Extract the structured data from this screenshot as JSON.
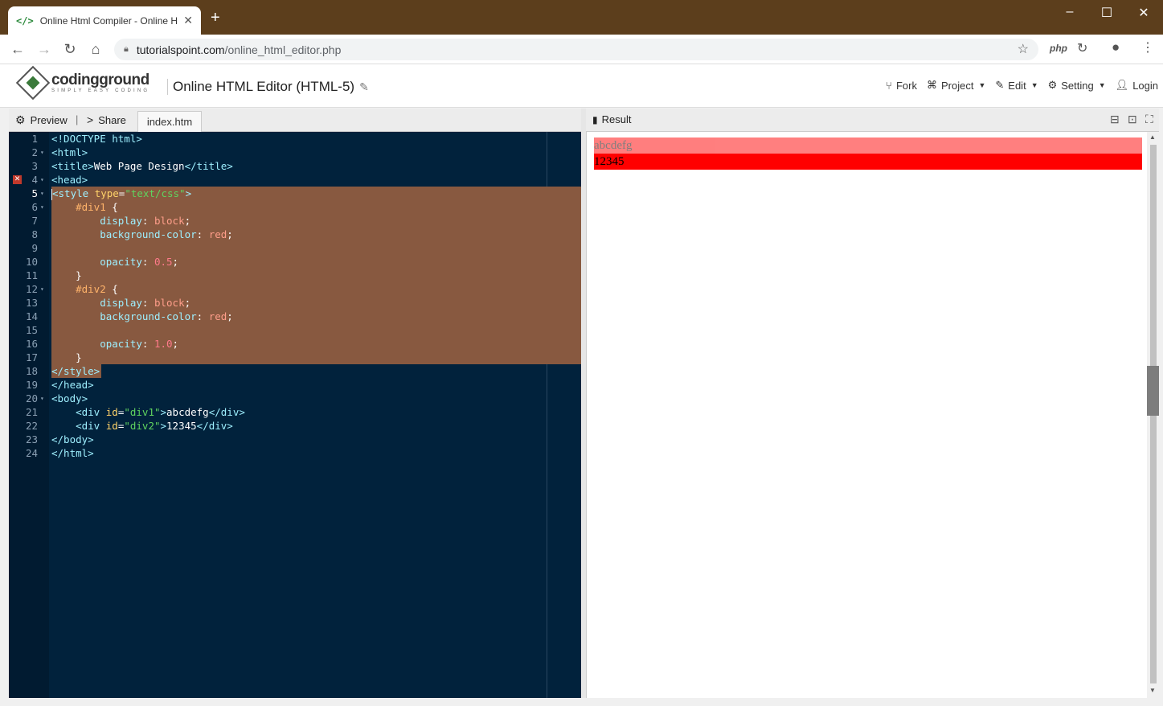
{
  "browser": {
    "tab_title": "Online Html Compiler - Online H",
    "tab_favicon": "</>",
    "new_tab": "+",
    "url_host": "tutorialspoint.com",
    "url_path": "/online_html_editor.php",
    "ext_php": "php"
  },
  "header": {
    "logo_name": "codingground",
    "logo_tagline": "SIMPLY EASY CODING",
    "page_title": "Online HTML Editor (HTML-5)",
    "menu": {
      "fork": "Fork",
      "project": "Project",
      "edit": "Edit",
      "setting": "Setting",
      "login": "Login"
    }
  },
  "editor_bar": {
    "preview": "Preview",
    "separator": "|",
    "share": "Share",
    "file_tab": "index.htm"
  },
  "editor": {
    "error_line": 4,
    "selection": {
      "from_line": 5,
      "to_line": 18
    },
    "line_numbers": [
      "1",
      "2",
      "3",
      "4",
      "5",
      "6",
      "7",
      "8",
      "9",
      "10",
      "11",
      "12",
      "13",
      "14",
      "15",
      "16",
      "17",
      "18",
      "19",
      "20",
      "21",
      "22",
      "23",
      "24"
    ],
    "tokens": {
      "l1": "<!DOCTYPE html>",
      "l2": "<html>",
      "l3_open": "<title>",
      "l3_text": "Web Page Design",
      "l3_close": "</title>",
      "l4": "<head>",
      "l5_tag": "<style",
      "l5_attr": "type",
      "l5_eq": "=",
      "l5_val": "\"text/css\"",
      "l5_end": ">",
      "l6_sel": "#div1",
      "l6_brace": " {",
      "l7_prop": "display",
      "l7_val": "block",
      "l8_prop": "background-color",
      "l8_val": "red",
      "l10_prop": "opacity",
      "l10_val": "0.5",
      "l11": "}",
      "l12_sel": "#div2",
      "l12_brace": " {",
      "l13_prop": "display",
      "l13_val": "block",
      "l14_prop": "background-color",
      "l14_val": "red",
      "l16_prop": "opacity",
      "l16_val": "1.0",
      "l17": "}",
      "l18": "</style>",
      "l19": "</head>",
      "l20": "<body>",
      "l21_tag": "<div",
      "l21_attr": "id",
      "l21_val": "\"div1\"",
      "l21_text": "abcdefg",
      "l21_close": "</div>",
      "l22_tag": "<div",
      "l22_attr": "id",
      "l22_val": "\"div2\"",
      "l22_text": "12345",
      "l22_close": "</div>",
      "l23": "</body>",
      "l24": "</html>"
    }
  },
  "result": {
    "title": "Result",
    "div1_text": "abcdefg",
    "div1_opacity": 0.5,
    "div2_text": "12345",
    "div2_opacity": 1.0,
    "div_bg": "#ff0000"
  },
  "colors": {
    "titlebar": "#5c3e1c",
    "editor_bg": "#01223c",
    "selection": "#885940"
  }
}
